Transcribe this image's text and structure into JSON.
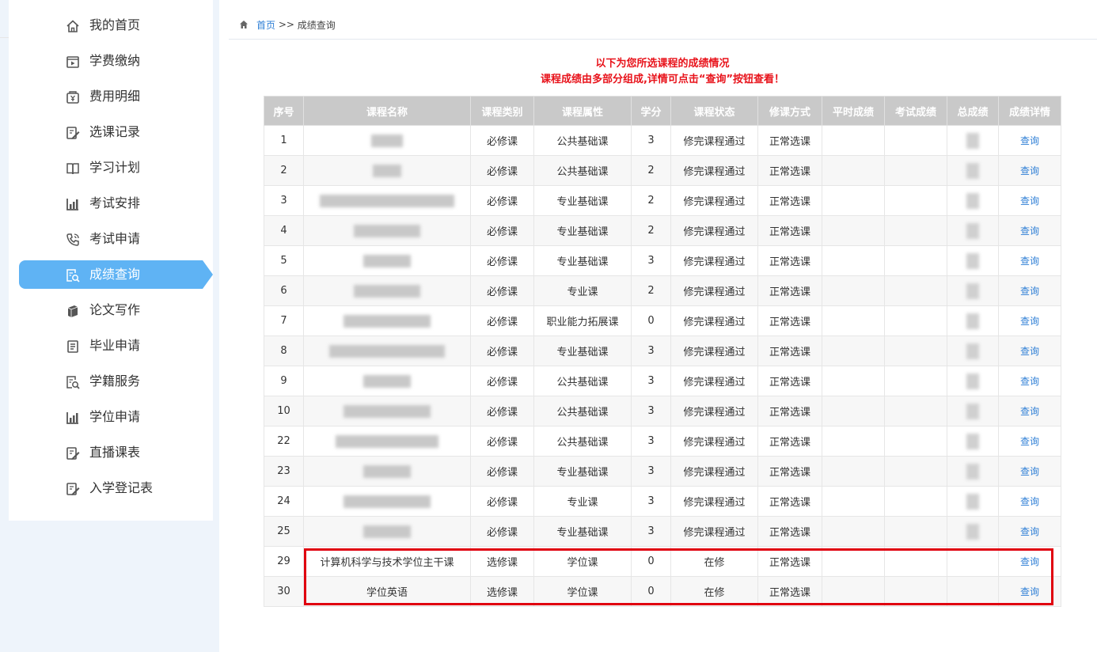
{
  "breadcrumb": {
    "home": "首页",
    "separator": ">>",
    "current": "成绩查询"
  },
  "sidebar": {
    "items": [
      {
        "label": "我的首页",
        "icon": "home-icon",
        "active": false
      },
      {
        "label": "学费缴纳",
        "icon": "payment-icon",
        "active": false
      },
      {
        "label": "费用明细",
        "icon": "fee-detail-icon",
        "active": false
      },
      {
        "label": "选课记录",
        "icon": "edit-record-icon",
        "active": false
      },
      {
        "label": "学习计划",
        "icon": "book-icon",
        "active": false
      },
      {
        "label": "考试安排",
        "icon": "chart-bar-icon",
        "active": false
      },
      {
        "label": "考试申请",
        "icon": "phone-icon",
        "active": false
      },
      {
        "label": "成绩查询",
        "icon": "search-doc-icon",
        "active": true
      },
      {
        "label": "论文写作",
        "icon": "paper-icon",
        "active": false
      },
      {
        "label": "毕业申请",
        "icon": "document-list-icon",
        "active": false
      },
      {
        "label": "学籍服务",
        "icon": "search-doc-icon",
        "active": false
      },
      {
        "label": "学位申请",
        "icon": "chart-bar-icon",
        "active": false
      },
      {
        "label": "直播课表",
        "icon": "edit-record-icon",
        "active": false
      },
      {
        "label": "入学登记表",
        "icon": "edit-record-icon",
        "active": false
      }
    ]
  },
  "notice": {
    "line1": "以下为您所选课程的成绩情况",
    "line2": "课程成绩由多部分组成,详情可点击“查询”按钮查看！"
  },
  "table": {
    "headers": [
      "序号",
      "课程名称",
      "课程类别",
      "课程属性",
      "学分",
      "课程状态",
      "修课方式",
      "平时成绩",
      "考试成绩",
      "总成绩",
      "成绩详情"
    ],
    "rows": [
      {
        "no": "1",
        "name": "",
        "category": "必修课",
        "attribute": "公共基础课",
        "credit": "3",
        "status": "修完课程通过",
        "mode": "正常选课",
        "usual": "",
        "exam": "",
        "total": "",
        "detail": "查询"
      },
      {
        "no": "2",
        "name": "",
        "category": "必修课",
        "attribute": "公共基础课",
        "credit": "2",
        "status": "修完课程通过",
        "mode": "正常选课",
        "usual": "",
        "exam": "",
        "total": "",
        "detail": "查询"
      },
      {
        "no": "3",
        "name": "",
        "category": "必修课",
        "attribute": "专业基础课",
        "credit": "2",
        "status": "修完课程通过",
        "mode": "正常选课",
        "usual": "",
        "exam": "",
        "total": "",
        "detail": "查询"
      },
      {
        "no": "4",
        "name": "",
        "category": "必修课",
        "attribute": "专业基础课",
        "credit": "2",
        "status": "修完课程通过",
        "mode": "正常选课",
        "usual": "",
        "exam": "",
        "total": "",
        "detail": "查询"
      },
      {
        "no": "5",
        "name": "",
        "category": "必修课",
        "attribute": "专业基础课",
        "credit": "3",
        "status": "修完课程通过",
        "mode": "正常选课",
        "usual": "",
        "exam": "",
        "total": "",
        "detail": "查询"
      },
      {
        "no": "6",
        "name": "",
        "category": "必修课",
        "attribute": "专业课",
        "credit": "2",
        "status": "修完课程通过",
        "mode": "正常选课",
        "usual": "",
        "exam": "",
        "total": "",
        "detail": "查询"
      },
      {
        "no": "7",
        "name": "",
        "category": "必修课",
        "attribute": "职业能力拓展课",
        "credit": "0",
        "status": "修完课程通过",
        "mode": "正常选课",
        "usual": "",
        "exam": "",
        "total": "",
        "detail": "查询"
      },
      {
        "no": "8",
        "name": "",
        "category": "必修课",
        "attribute": "专业基础课",
        "credit": "3",
        "status": "修完课程通过",
        "mode": "正常选课",
        "usual": "",
        "exam": "",
        "total": "",
        "detail": "查询"
      },
      {
        "no": "9",
        "name": "",
        "category": "必修课",
        "attribute": "公共基础课",
        "credit": "3",
        "status": "修完课程通过",
        "mode": "正常选课",
        "usual": "",
        "exam": "",
        "total": "",
        "detail": "查询"
      },
      {
        "no": "10",
        "name": "",
        "category": "必修课",
        "attribute": "公共基础课",
        "credit": "3",
        "status": "修完课程通过",
        "mode": "正常选课",
        "usual": "",
        "exam": "",
        "total": "",
        "detail": "查询"
      },
      {
        "no": "22",
        "name": "",
        "category": "必修课",
        "attribute": "公共基础课",
        "credit": "3",
        "status": "修完课程通过",
        "mode": "正常选课",
        "usual": "",
        "exam": "",
        "total": "",
        "detail": "查询"
      },
      {
        "no": "23",
        "name": "",
        "category": "必修课",
        "attribute": "专业基础课",
        "credit": "3",
        "status": "修完课程通过",
        "mode": "正常选课",
        "usual": "",
        "exam": "",
        "total": "",
        "detail": "查询"
      },
      {
        "no": "24",
        "name": "",
        "category": "必修课",
        "attribute": "专业课",
        "credit": "3",
        "status": "修完课程通过",
        "mode": "正常选课",
        "usual": "",
        "exam": "",
        "total": "",
        "detail": "查询"
      },
      {
        "no": "25",
        "name": "",
        "category": "必修课",
        "attribute": "专业基础课",
        "credit": "3",
        "status": "修完课程通过",
        "mode": "正常选课",
        "usual": "",
        "exam": "",
        "total": "",
        "detail": "查询"
      },
      {
        "no": "29",
        "name": "计算机科学与技术学位主干课",
        "category": "选修课",
        "attribute": "学位课",
        "credit": "0",
        "status": "在修",
        "mode": "正常选课",
        "usual": "",
        "exam": "",
        "total": "",
        "detail": "查询"
      },
      {
        "no": "30",
        "name": "学位英语",
        "category": "选修课",
        "attribute": "学位课",
        "credit": "0",
        "status": "在修",
        "mode": "正常选课",
        "usual": "",
        "exam": "",
        "total": "",
        "detail": "查询"
      }
    ]
  },
  "colors": {
    "accent": "#5fb3f4",
    "link": "#2f7fd6",
    "notice": "#e8131b",
    "header_bg": "#c9c9c9",
    "highlight": "#e0000f"
  }
}
